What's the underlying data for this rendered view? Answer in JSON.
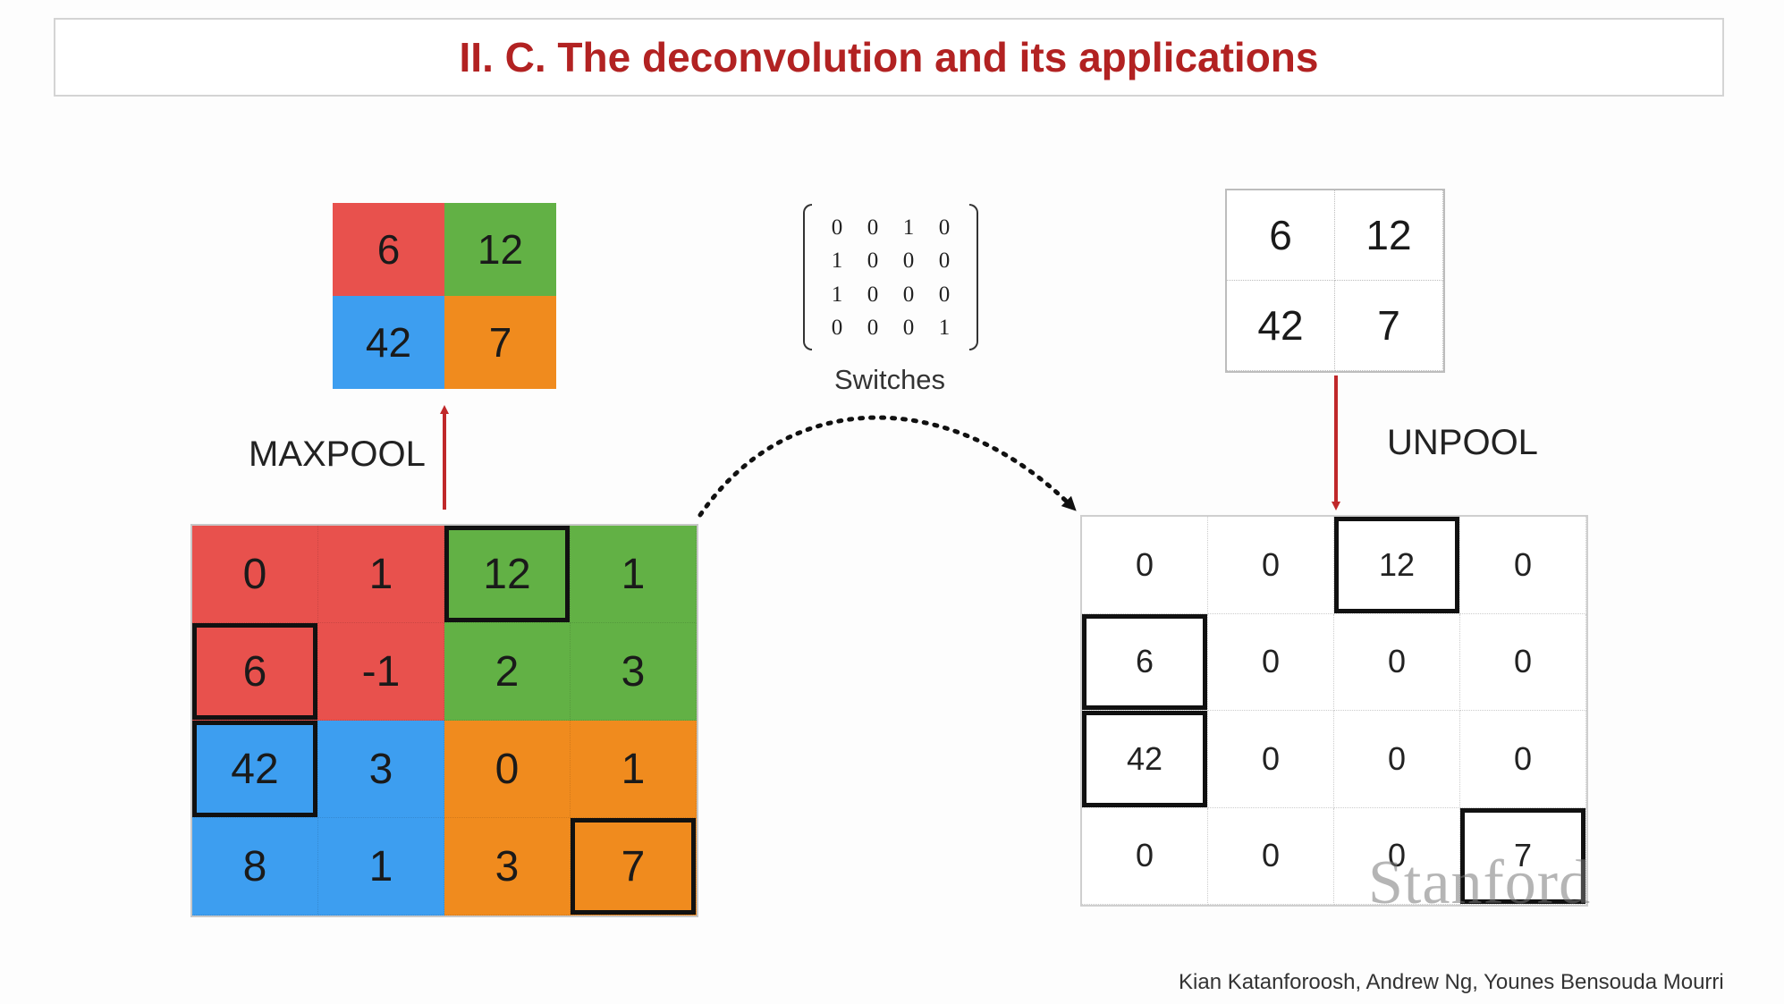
{
  "title": "II. C. The deconvolution and its applications",
  "pooled_output": {
    "cells": [
      {
        "value": "6",
        "color": "red"
      },
      {
        "value": "12",
        "color": "green"
      },
      {
        "value": "42",
        "color": "blue"
      },
      {
        "value": "7",
        "color": "orange"
      }
    ]
  },
  "maxpool_label": "MAXPOOL",
  "input_matrix": {
    "cells": [
      {
        "value": "0",
        "color": "red",
        "max": false
      },
      {
        "value": "1",
        "color": "red",
        "max": false
      },
      {
        "value": "12",
        "color": "green",
        "max": true
      },
      {
        "value": "1",
        "color": "green",
        "max": false
      },
      {
        "value": "6",
        "color": "red",
        "max": true
      },
      {
        "value": "-1",
        "color": "red",
        "max": false
      },
      {
        "value": "2",
        "color": "green",
        "max": false
      },
      {
        "value": "3",
        "color": "green",
        "max": false
      },
      {
        "value": "42",
        "color": "blue",
        "max": true
      },
      {
        "value": "3",
        "color": "blue",
        "max": false
      },
      {
        "value": "0",
        "color": "orange",
        "max": false
      },
      {
        "value": "1",
        "color": "orange",
        "max": false
      },
      {
        "value": "8",
        "color": "blue",
        "max": false
      },
      {
        "value": "1",
        "color": "blue",
        "max": false
      },
      {
        "value": "3",
        "color": "orange",
        "max": false
      },
      {
        "value": "7",
        "color": "orange",
        "max": true
      }
    ]
  },
  "switches": {
    "rows": [
      [
        "0",
        "0",
        "1",
        "0"
      ],
      [
        "1",
        "0",
        "0",
        "0"
      ],
      [
        "1",
        "0",
        "0",
        "0"
      ],
      [
        "0",
        "0",
        "0",
        "1"
      ]
    ],
    "label": "Switches"
  },
  "unpool_input": {
    "cells": [
      "6",
      "12",
      "42",
      "7"
    ]
  },
  "unpool_label": "UNPOOL",
  "unpool_output": {
    "cells": [
      {
        "value": "0",
        "max": false
      },
      {
        "value": "0",
        "max": false
      },
      {
        "value": "12",
        "max": true
      },
      {
        "value": "0",
        "max": false
      },
      {
        "value": "6",
        "max": true
      },
      {
        "value": "0",
        "max": false
      },
      {
        "value": "0",
        "max": false
      },
      {
        "value": "0",
        "max": false
      },
      {
        "value": "42",
        "max": true
      },
      {
        "value": "0",
        "max": false
      },
      {
        "value": "0",
        "max": false
      },
      {
        "value": "0",
        "max": false
      },
      {
        "value": "0",
        "max": false
      },
      {
        "value": "0",
        "max": false
      },
      {
        "value": "0",
        "max": false
      },
      {
        "value": "7",
        "max": true
      }
    ]
  },
  "logo_text": "Stanford",
  "authors": "Kian Katanforoosh, Andrew Ng, Younes Bensouda Mourri",
  "colors": {
    "red": "#e8514d",
    "green": "#62b145",
    "blue": "#3d9ef0",
    "orange": "#f08b1e",
    "title": "#b22222",
    "arrow": "#c0282a"
  }
}
